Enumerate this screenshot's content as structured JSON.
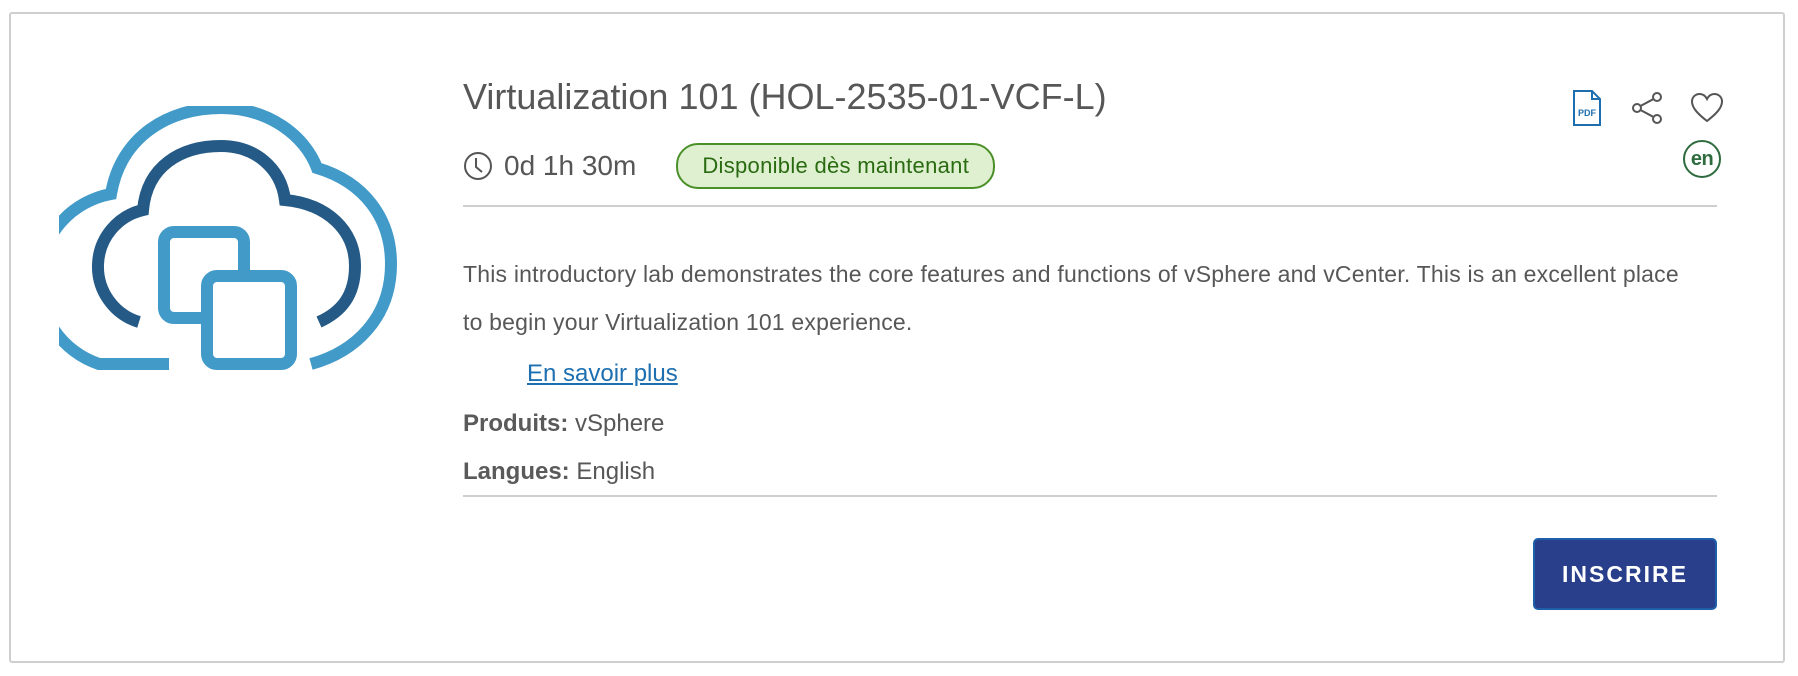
{
  "lab": {
    "title": "Virtualization 101 (HOL-2535-01-VCF-L)",
    "duration": "0d 1h 30m",
    "availability": "Disponible dès maintenant",
    "language_code": "en",
    "description": "This introductory lab demonstrates the core features and functions of vSphere and vCenter. This is an excellent place to begin your Virtualization 101 experience.",
    "learn_more": "En savoir plus",
    "products_label": "Produits:",
    "products_value": "vSphere",
    "languages_label": "Langues:",
    "languages_value": "English",
    "enroll_label": "INSCRIRE"
  },
  "icons": {
    "logo": "cloud-virtual-machines-logo",
    "pdf": "pdf-icon",
    "pdf_text": "PDF",
    "share": "share-icon",
    "favorite": "heart-icon",
    "clock": "clock-icon"
  },
  "colors": {
    "logo_light": "#429ac9",
    "logo_dark": "#255a86",
    "badge_bg": "#dff0d0",
    "badge_border": "#4b8f29",
    "link": "#1d6fb0",
    "button_bg": "#2a3f8b"
  }
}
